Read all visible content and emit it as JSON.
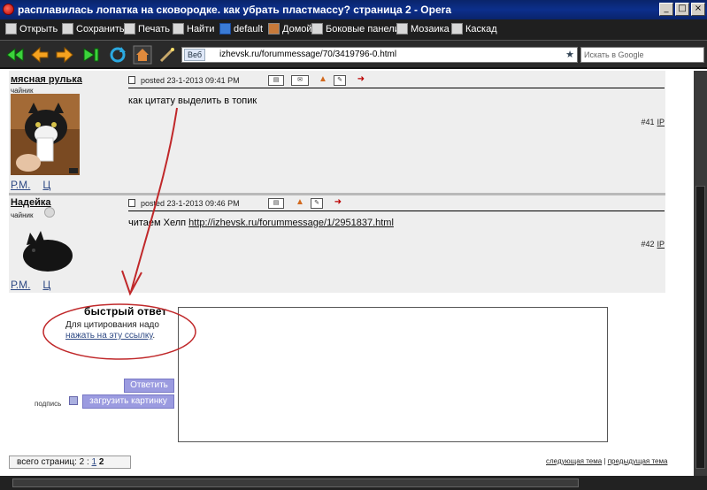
{
  "window": {
    "title": "расплавилась лопатка на сковородке. как убрать пластмассу? страница 2 - Opera"
  },
  "menubar": {
    "items": [
      {
        "label": "Открыть",
        "icon": "folder-open-icon"
      },
      {
        "label": "Сохранить",
        "icon": "save-icon"
      },
      {
        "label": "Печать",
        "icon": "print-icon"
      },
      {
        "label": "Найти",
        "icon": "find-icon"
      },
      {
        "label": "default",
        "icon": "play-icon"
      },
      {
        "label": "Домой",
        "icon": "home-icon"
      },
      {
        "label": "Боковые панели",
        "icon": "panels-icon"
      },
      {
        "label": "Мозаика",
        "icon": "tile-icon"
      },
      {
        "label": "Каскад",
        "icon": "cascade-icon"
      }
    ]
  },
  "navbar": {
    "address_badge": "Веб",
    "url": "izhevsk.ru/forummessage/70/3419796-0.html",
    "search_placeholder": "Искать в Google"
  },
  "posts": [
    {
      "username": "мясная рулька",
      "rank": "чайник",
      "date": "posted 23-1-2013 09:41 PM",
      "message": "как цитату выделить в топик",
      "number": "#41",
      "ip": "IP",
      "links": [
        "Р.М.",
        "Ц"
      ]
    },
    {
      "username": "Надейка",
      "rank": "чайник",
      "date": "posted 23-1-2013 09:46 PM",
      "message_prefix": "читаем Хелп",
      "message_link": "http://izhevsk.ru/forummessage/1/2951837.html",
      "number": "#42",
      "ip": "IP",
      "links": [
        "Р.М.",
        "Ц"
      ]
    }
  ],
  "quick_reply": {
    "title": "быстрый ответ",
    "hint_line1": "Для цитирования надо",
    "hint_link": "нажать на эту ссылку",
    "hint_end": ".",
    "reply_button": "Ответить",
    "signature_label": "подпись",
    "upload_button": "загрузить картинку"
  },
  "pager": {
    "label": "всего страниц: 2 :",
    "page1": "1",
    "page2": "2"
  },
  "thread_nav": {
    "next": "следующая тема",
    "separator": "|",
    "prev": "предыдущая тема"
  },
  "colors": {
    "post_bg": "#eeeeee",
    "button_bg": "#9b9be0",
    "link": "#2f4a85",
    "annotation": "#c0282a"
  }
}
